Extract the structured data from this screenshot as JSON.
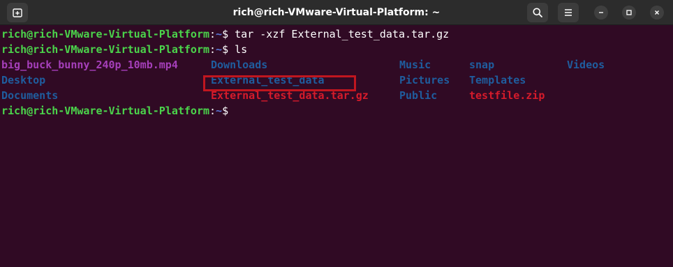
{
  "window": {
    "title": "rich@rich-VMware-Virtual-Platform: ~"
  },
  "icons": {
    "new_tab": "new-tab-icon",
    "search": "search-icon",
    "menu": "hamburger-menu-icon",
    "minimize": "minimize-icon",
    "maximize": "maximize-icon",
    "close": "close-icon"
  },
  "colors": {
    "background": "#300a24",
    "prompt_user": "#4bd44b",
    "prompt_path": "#5a78d8",
    "video_file": "#a53fba",
    "directory": "#1f5d9e",
    "archive": "#d61b2b",
    "highlight": "#c0161f"
  },
  "terminal": {
    "prompt_user": "rich@rich-VMware-Virtual-Platform",
    "prompt_colon": ":",
    "prompt_path": "~",
    "prompt_symbol": "$",
    "lines": [
      {
        "command": " tar -xzf External_test_data.tar.gz"
      },
      {
        "command": " ls"
      }
    ],
    "ls_output": {
      "rows": [
        [
          {
            "name": "big_buck_bunny_240p_10mb.mp4",
            "type": "video"
          },
          {
            "name": "Downloads",
            "type": "directory"
          },
          {
            "name": "Music",
            "type": "directory"
          },
          {
            "name": "snap",
            "type": "directory"
          },
          {
            "name": "Videos",
            "type": "directory"
          }
        ],
        [
          {
            "name": "Desktop",
            "type": "directory"
          },
          {
            "name": "External_test_data",
            "type": "directory"
          },
          {
            "name": "Pictures",
            "type": "directory"
          },
          {
            "name": "Templates",
            "type": "directory"
          }
        ],
        [
          {
            "name": "Documents",
            "type": "directory"
          },
          {
            "name": "External_test_data.tar.gz",
            "type": "archive"
          },
          {
            "name": "Public",
            "type": "directory"
          },
          {
            "name": "testfile.zip",
            "type": "archive"
          }
        ]
      ]
    },
    "final_command": ""
  }
}
